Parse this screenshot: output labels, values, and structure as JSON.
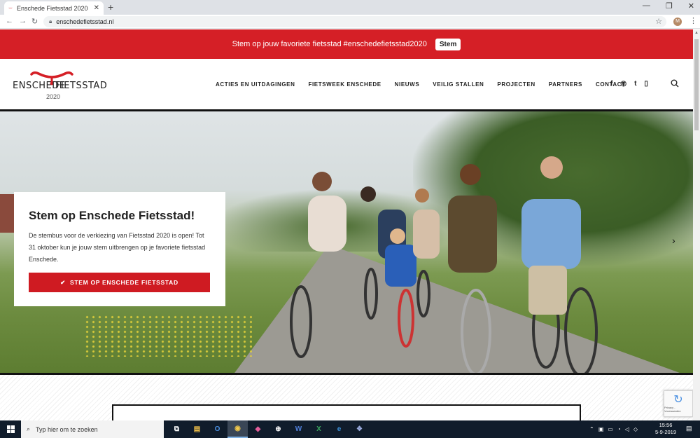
{
  "browser": {
    "tab_title": "Enschede Fietsstad 2020",
    "url": "enschedefietsstad.nl",
    "profile_initial": "M"
  },
  "banner": {
    "text": "Stem op jouw favoriete fietsstad #enschedefietsstad2020",
    "button": "Stem"
  },
  "logo": {
    "word1": "ENSCHEDE",
    "word2": "FIETSSTAD",
    "year": "2020"
  },
  "nav": {
    "items": [
      "ACTIES EN UITDAGINGEN",
      "FIETSWEEK ENSCHEDE",
      "NIEUWS",
      "VEILIG STALLEN",
      "PROJECTEN",
      "PARTNERS",
      "CONTACT"
    ],
    "social": [
      "f",
      "◎",
      "t",
      "▯"
    ]
  },
  "hero": {
    "title": "Stem op Enschede Fietsstad!",
    "body": "De stembus voor de verkiezing van Fietsstad 2020 is open! Tot 31 oktober kun je jouw stem uitbrengen op je favoriete fietsstad Enschede.",
    "cta_icon": "✔",
    "cta": "STEM OP ENSCHEDE FIETSSTAD",
    "prev_arrow": "‹",
    "next_arrow": "›"
  },
  "recaptcha": {
    "text": "Privacy - Voorwaarden"
  },
  "taskbar": {
    "search_placeholder": "Typ hier om te zoeken",
    "apps": [
      "⧉",
      "▤",
      "O",
      "◉",
      "◆",
      "⊕",
      "W",
      "X",
      "e",
      "❖"
    ],
    "time": "15:56",
    "date": "5-9-2019"
  },
  "colors": {
    "brand_red": "#d51f26",
    "cta_red": "#cf1b22"
  }
}
